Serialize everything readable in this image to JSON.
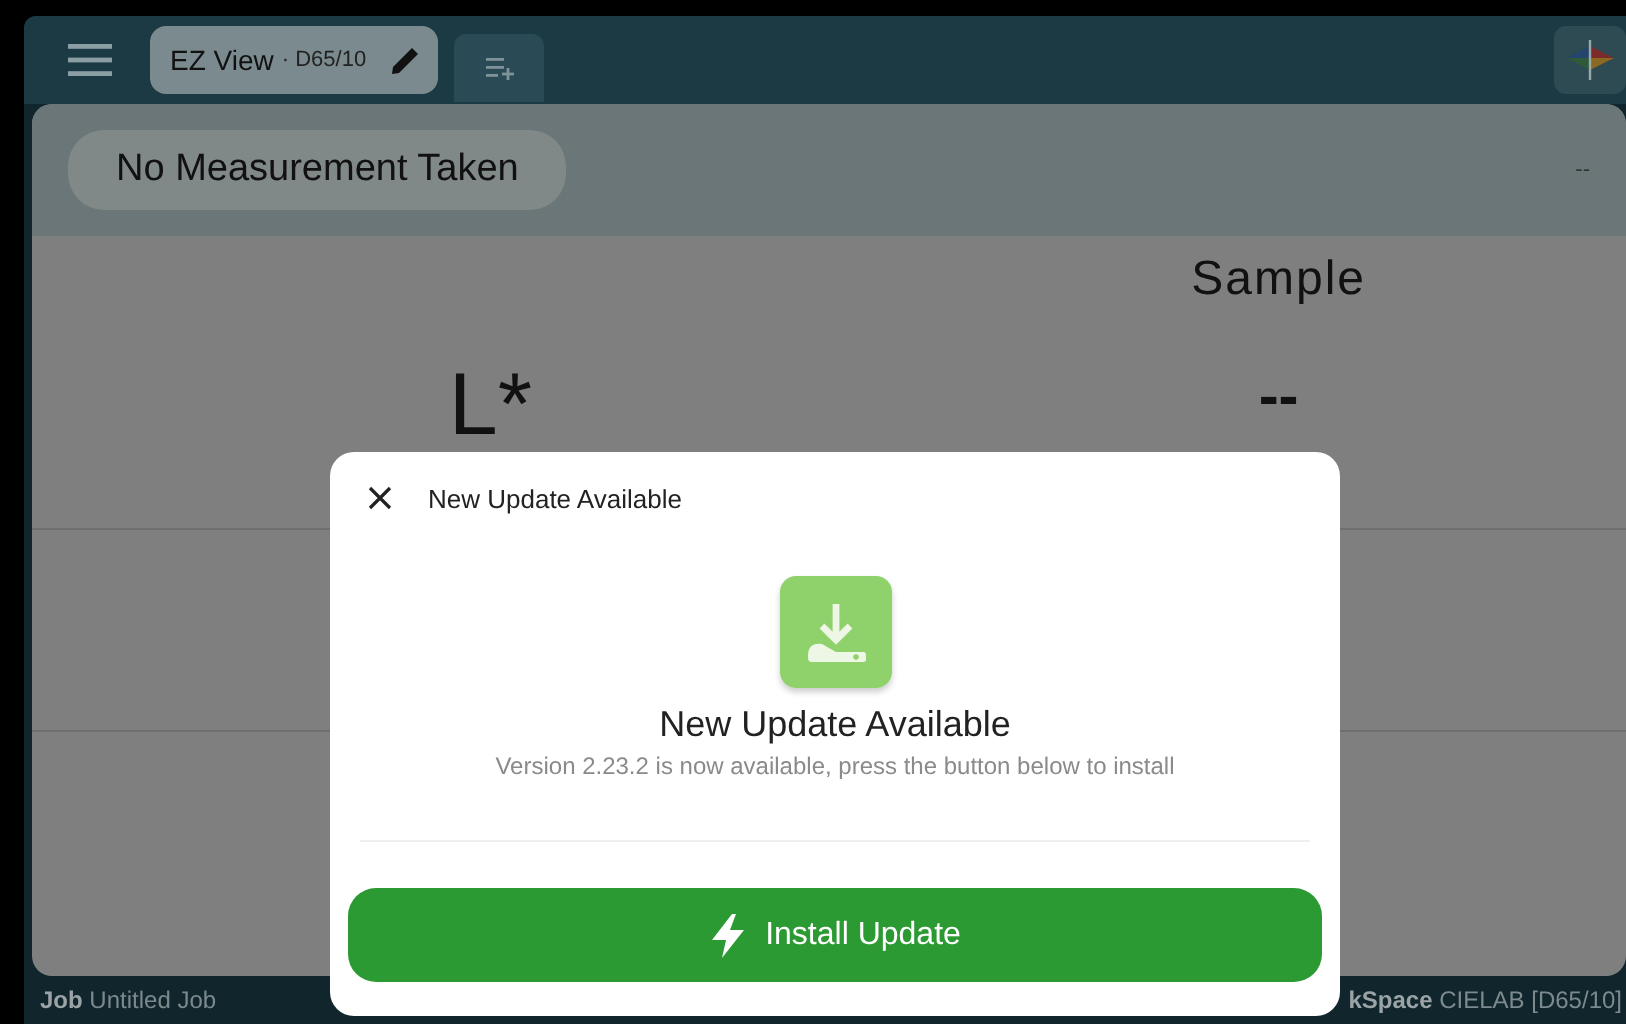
{
  "toolbar": {
    "view_tab": {
      "label": "EZ View",
      "illuminant": "· D65/10"
    }
  },
  "status": {
    "label": "No Measurement Taken",
    "value": "--"
  },
  "table": {
    "columns": [
      "Sample"
    ],
    "rows": [
      {
        "label": "L*",
        "values": [
          "--"
        ]
      }
    ]
  },
  "footer": {
    "job_label": "Job",
    "job": "Untitled Job",
    "workspace_label": "kSpace",
    "workspace": "CIELAB [D65/10]"
  },
  "dialog": {
    "title": "New Update Available",
    "heading": "New Update Available",
    "message": "Version 2.23.2 is now available, press the button below to install",
    "button": "Install Update"
  }
}
